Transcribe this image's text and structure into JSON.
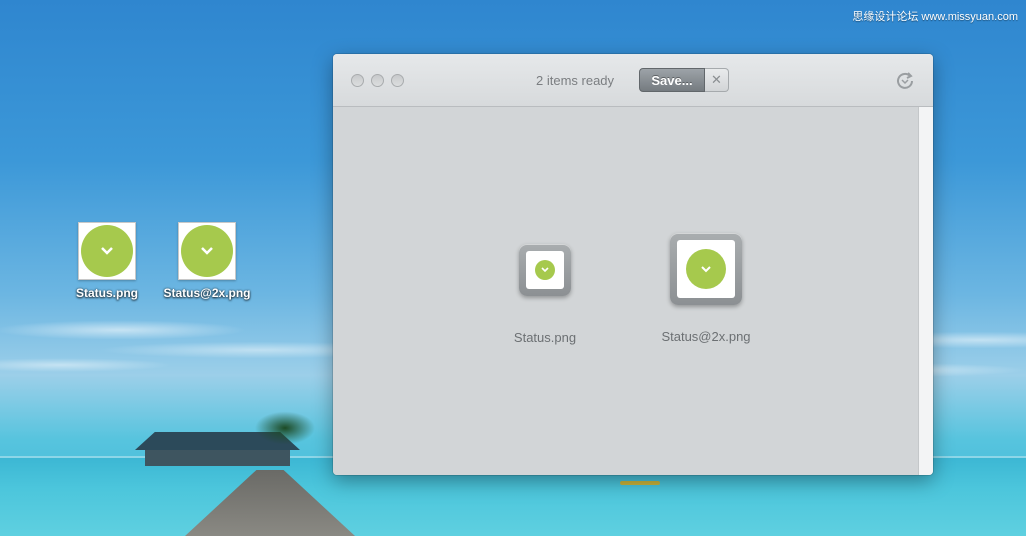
{
  "watermark": "思缘设计论坛 www.missyuan.com",
  "desktop": {
    "icons": [
      {
        "label": "Status.png",
        "icon": "status-image-icon"
      },
      {
        "label": "Status@2x.png",
        "icon": "status-image-icon"
      }
    ]
  },
  "window": {
    "status_text": "2 items ready",
    "save_label": "Save...",
    "close_label": "✕",
    "refresh_icon": "refresh-icon",
    "files": [
      {
        "name": "Status.png",
        "icon": "status-image-icon"
      },
      {
        "name": "Status@2x.png",
        "icon": "status-image-icon"
      }
    ]
  },
  "colors": {
    "accent_green": "#a6c94d",
    "save_button": "#7f858a",
    "window_bg": "#d3d6d8"
  }
}
